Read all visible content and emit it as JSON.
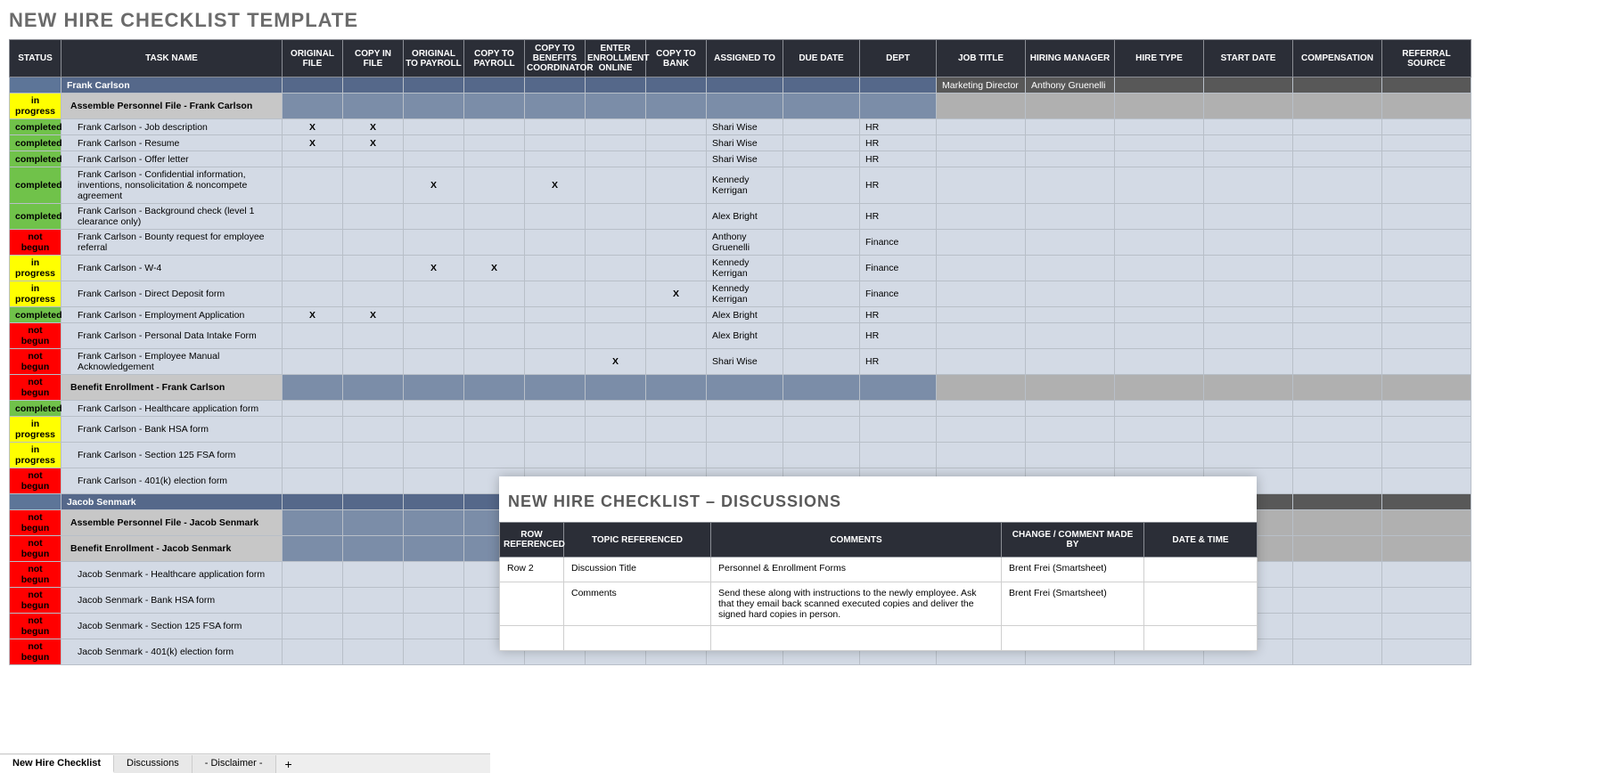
{
  "title": "NEW HIRE CHECKLIST TEMPLATE",
  "columns": [
    "STATUS",
    "TASK NAME",
    "ORIGINAL FILE",
    "COPY IN FILE",
    "ORIGINAL TO PAYROLL",
    "COPY TO PAYROLL",
    "COPY TO BENEFITS COORDINATOR",
    "ENTER ENROLLMENT ONLINE",
    "COPY TO BANK",
    "ASSIGNED TO",
    "DUE DATE",
    "DEPT",
    "JOB TITLE",
    "HIRING MANAGER",
    "HIRE TYPE",
    "START DATE",
    "COMPENSATION",
    "REFERRAL SOURCE"
  ],
  "rows": [
    {
      "type": "person",
      "status": "",
      "task": "Frank Carlson",
      "chk": [
        "",
        "",
        "",
        "",
        "",
        "",
        ""
      ],
      "assigned": "",
      "due": "",
      "dept": "",
      "job": "Marketing Director",
      "mgr": "Anthony Gruenelli"
    },
    {
      "type": "section",
      "status": "in progress",
      "task": "Assemble Personnel File - Frank Carlson",
      "chk": [
        "",
        "",
        "",
        "",
        "",
        "",
        ""
      ],
      "assigned": "",
      "due": "",
      "dept": ""
    },
    {
      "type": "data",
      "status": "completed",
      "task": "Frank Carlson - Job description",
      "chk": [
        "X",
        "X",
        "",
        "",
        "",
        "",
        ""
      ],
      "assigned": "Shari Wise",
      "due": "",
      "dept": "HR"
    },
    {
      "type": "data",
      "status": "completed",
      "task": "Frank Carlson - Resume",
      "chk": [
        "X",
        "X",
        "",
        "",
        "",
        "",
        ""
      ],
      "assigned": "Shari Wise",
      "due": "",
      "dept": "HR"
    },
    {
      "type": "data",
      "status": "completed",
      "task": "Frank Carlson - Offer letter",
      "chk": [
        "",
        "",
        "",
        "",
        "",
        "",
        ""
      ],
      "assigned": "Shari Wise",
      "due": "",
      "dept": "HR"
    },
    {
      "type": "data",
      "status": "completed",
      "task": "Frank Carlson - Confidential information, inventions, nonsolicitation & noncompete agreement",
      "chk": [
        "",
        "",
        "X",
        "",
        "X",
        "",
        ""
      ],
      "assigned": "Kennedy Kerrigan",
      "due": "",
      "dept": "HR"
    },
    {
      "type": "data",
      "status": "completed",
      "task": "Frank Carlson - Background check (level 1 clearance only)",
      "chk": [
        "",
        "",
        "",
        "",
        "",
        "",
        ""
      ],
      "assigned": "Alex Bright",
      "due": "",
      "dept": "HR"
    },
    {
      "type": "data",
      "status": "not begun",
      "task": "Frank Carlson - Bounty request for employee referral",
      "chk": [
        "",
        "",
        "",
        "",
        "",
        "",
        ""
      ],
      "assigned": "Anthony Gruenelli",
      "due": "",
      "dept": "Finance"
    },
    {
      "type": "data",
      "status": "in progress",
      "task": "Frank Carlson - W-4",
      "chk": [
        "",
        "",
        "X",
        "X",
        "",
        "",
        ""
      ],
      "assigned": "Kennedy Kerrigan",
      "due": "",
      "dept": "Finance"
    },
    {
      "type": "data",
      "status": "in progress",
      "task": "Frank Carlson - Direct Deposit form",
      "chk": [
        "",
        "",
        "",
        "",
        "",
        "",
        "X"
      ],
      "assigned": "Kennedy Kerrigan",
      "due": "",
      "dept": "Finance"
    },
    {
      "type": "data",
      "status": "completed",
      "task": "Frank Carlson - Employment Application",
      "chk": [
        "X",
        "X",
        "",
        "",
        "",
        "",
        ""
      ],
      "assigned": "Alex Bright",
      "due": "",
      "dept": "HR"
    },
    {
      "type": "data",
      "status": "not begun",
      "task": "Frank Carlson - Personal Data Intake Form",
      "chk": [
        "",
        "",
        "",
        "",
        "",
        "",
        ""
      ],
      "assigned": "Alex Bright",
      "due": "",
      "dept": "HR"
    },
    {
      "type": "data",
      "status": "not begun",
      "task": "Frank Carlson - Employee Manual Acknowledgement",
      "chk": [
        "",
        "",
        "",
        "",
        "",
        "X",
        ""
      ],
      "assigned": "Shari Wise",
      "due": "",
      "dept": "HR"
    },
    {
      "type": "section",
      "status": "not begun",
      "task": "Benefit Enrollment - Frank Carlson",
      "chk": [
        "",
        "",
        "",
        "",
        "",
        "",
        ""
      ],
      "assigned": "",
      "due": "",
      "dept": ""
    },
    {
      "type": "data",
      "status": "completed",
      "task": "Frank Carlson - Healthcare application form",
      "chk": [
        "",
        "",
        "",
        "",
        "",
        "",
        ""
      ],
      "assigned": "",
      "due": "",
      "dept": ""
    },
    {
      "type": "data",
      "status": "in progress",
      "task": "Frank Carlson - Bank HSA form",
      "chk": [
        "",
        "",
        "",
        "",
        "",
        "",
        ""
      ],
      "assigned": "",
      "due": "",
      "dept": ""
    },
    {
      "type": "data",
      "status": "in progress",
      "task": "Frank Carlson - Section 125 FSA form",
      "chk": [
        "",
        "",
        "",
        "",
        "",
        "",
        ""
      ],
      "assigned": "",
      "due": "",
      "dept": ""
    },
    {
      "type": "data",
      "status": "not begun",
      "task": "Frank Carlson - 401(k) election form",
      "chk": [
        "",
        "",
        "",
        "",
        "",
        "",
        ""
      ],
      "assigned": "",
      "due": "",
      "dept": ""
    },
    {
      "type": "person",
      "status": "",
      "task": "Jacob Senmark",
      "chk": [
        "",
        "",
        "",
        "",
        "",
        "",
        ""
      ],
      "assigned": "",
      "due": "",
      "dept": "",
      "job": "",
      "mgr": ""
    },
    {
      "type": "section",
      "status": "not begun",
      "task": "Assemble Personnel File - Jacob Senmark",
      "chk": [
        "",
        "",
        "",
        "",
        "",
        "",
        ""
      ],
      "assigned": "",
      "due": "",
      "dept": ""
    },
    {
      "type": "section",
      "status": "not begun",
      "task": "Benefit Enrollment - Jacob Senmark",
      "chk": [
        "",
        "",
        "",
        "",
        "",
        "",
        ""
      ],
      "assigned": "",
      "due": "",
      "dept": ""
    },
    {
      "type": "data",
      "status": "not begun",
      "task": "Jacob Senmark - Healthcare application form",
      "chk": [
        "",
        "",
        "",
        "",
        "",
        "",
        ""
      ],
      "assigned": "",
      "due": "",
      "dept": ""
    },
    {
      "type": "data",
      "status": "not begun",
      "task": "Jacob Senmark - Bank HSA form",
      "chk": [
        "",
        "",
        "",
        "",
        "",
        "",
        ""
      ],
      "assigned": "",
      "due": "",
      "dept": ""
    },
    {
      "type": "data",
      "status": "not begun",
      "task": "Jacob Senmark - Section 125 FSA form",
      "chk": [
        "",
        "",
        "",
        "",
        "",
        "",
        ""
      ],
      "assigned": "",
      "due": "",
      "dept": ""
    },
    {
      "type": "data",
      "status": "not begun",
      "task": "Jacob Senmark - 401(k) election form",
      "chk": [
        "",
        "",
        "",
        "",
        "",
        "",
        ""
      ],
      "assigned": "",
      "due": "",
      "dept": ""
    }
  ],
  "discussions": {
    "title": "NEW HIRE CHECKLIST  –  DISCUSSIONS",
    "columns": [
      "ROW REFERENCED",
      "TOPIC REFERENCED",
      "COMMENTS",
      "CHANGE / COMMENT MADE BY",
      "DATE & TIME"
    ],
    "rows": [
      {
        "row": "Row 2",
        "topic": "Discussion Title",
        "comments": "Personnel & Enrollment Forms",
        "by": "Brent Frei (Smartsheet)",
        "date": ""
      },
      {
        "row": "",
        "topic": "Comments",
        "comments": "Send these along with instructions to the newly employee.  Ask that they email back scanned executed copies and deliver the signed hard copies in person.",
        "by": "Brent Frei (Smartsheet)",
        "date": ""
      },
      {
        "row": "",
        "topic": "",
        "comments": "",
        "by": "",
        "date": ""
      }
    ]
  },
  "tabs": {
    "items": [
      "New Hire Checklist",
      "Discussions",
      "- Disclaimer -"
    ],
    "active": 0,
    "add": "+"
  }
}
